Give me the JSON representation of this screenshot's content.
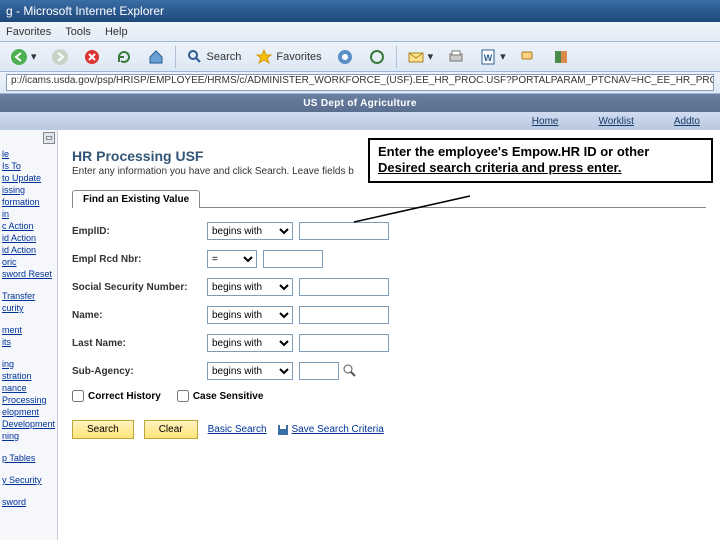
{
  "window": {
    "title": "g - Microsoft Internet Explorer"
  },
  "menu": {
    "favorites": "Favorites",
    "tools": "Tools",
    "help": "Help"
  },
  "toolbar": {
    "search": "Search",
    "favorites": "Favorites"
  },
  "address": {
    "url": "p://icams.usda.gov/psp/HRISP/EMPLOYEE/HRMS/c/ADMINISTER_WORKFORCE_(USF).EE_HR_PROC.USF?PORTALPARAM_PTCNAV=HC_EE_HR_PROC_USF&EOPP.SCNode=HRMS&EOPP.SCPortal=EMPL"
  },
  "header": {
    "org": "US Dept of Agriculture"
  },
  "topnav": {
    "home": "Home",
    "worklist": "Worklist",
    "addto": "Addto"
  },
  "sidebar": {
    "items": [
      "le",
      "Is To",
      "to Update",
      "issing",
      "formation",
      "in",
      "c Action",
      "id Action",
      "id Action",
      "oric",
      "sword Reset",
      "Transfer",
      "curity",
      "ment",
      "its",
      "ing",
      "stration",
      "nance",
      "Processing",
      "elopment",
      "Development",
      "ning",
      "p Tables",
      "y Security",
      "sword"
    ]
  },
  "page": {
    "title": "HR Processing USF",
    "subtitle": "Enter any information you have and click Search. Leave fields b",
    "tab": "Find an Existing Value"
  },
  "fields": {
    "emplid": {
      "label": "EmplID:",
      "op": "begins with"
    },
    "rcd": {
      "label": "Empl Rcd Nbr:",
      "op": "="
    },
    "ssn": {
      "label": "Social Security Number:",
      "op": "begins with"
    },
    "name": {
      "label": "Name:",
      "op": "begins with"
    },
    "last": {
      "label": "Last Name:",
      "op": "begins with"
    },
    "agency": {
      "label": "Sub-Agency:",
      "op": "begins with"
    }
  },
  "checks": {
    "correct": "Correct History",
    "case": "Case Sensitive"
  },
  "buttons": {
    "search": "Search",
    "clear": "Clear",
    "basic": "Basic Search",
    "save": "Save Search Criteria"
  },
  "callout": {
    "line1": "Enter the employee's Empow.HR ID or other",
    "line2": "Desired search criteria and press enter."
  }
}
